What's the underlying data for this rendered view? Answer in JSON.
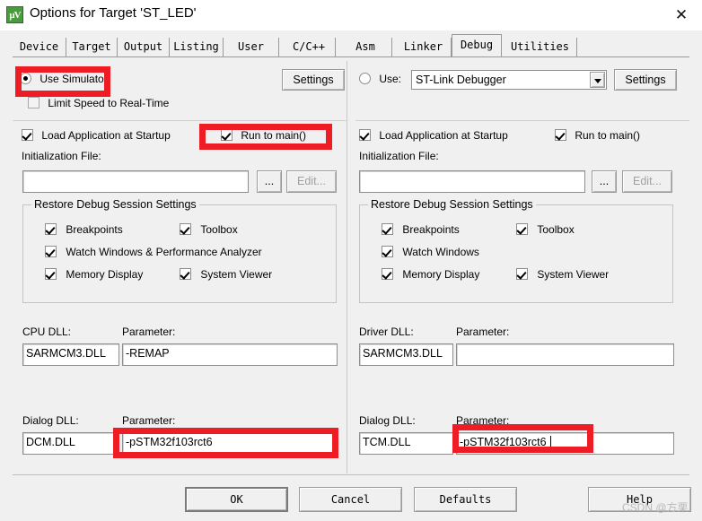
{
  "window": {
    "title": "Options for Target 'ST_LED'",
    "icon": "keil-uvision-icon",
    "close_label": "✕"
  },
  "tabs": [
    {
      "label": "Device",
      "active": false
    },
    {
      "label": "Target",
      "active": false
    },
    {
      "label": "Output",
      "active": false
    },
    {
      "label": "Listing",
      "active": false
    },
    {
      "label": "User",
      "active": false
    },
    {
      "label": "C/C++",
      "active": false
    },
    {
      "label": "Asm",
      "active": false
    },
    {
      "label": "Linker",
      "active": false
    },
    {
      "label": "Debug",
      "active": true
    },
    {
      "label": "Utilities",
      "active": false
    }
  ],
  "left_panel": {
    "use_simulator_label": "Use Simulator",
    "use_simulator_checked": true,
    "settings_label": "Settings",
    "limit_speed_label": "Limit Speed to Real-Time",
    "limit_speed_checked": false,
    "load_app_label": "Load Application at Startup",
    "load_app_checked": true,
    "run_to_main_label": "Run to main()",
    "run_to_main_checked": true,
    "init_file_label": "Initialization File:",
    "init_file_value": "",
    "browse_label": "...",
    "edit_label": "Edit...",
    "restore_group_label": "Restore Debug Session Settings",
    "restore_items": [
      {
        "label": "Breakpoints",
        "checked": true
      },
      {
        "label": "Toolbox",
        "checked": true
      },
      {
        "label": "Watch Windows & Performance Analyzer",
        "checked": true
      },
      {
        "label": "Memory Display",
        "checked": true
      },
      {
        "label": "System Viewer",
        "checked": true
      }
    ],
    "cpu_dll_label": "CPU DLL:",
    "cpu_dll_value": "SARMCM3.DLL",
    "cpu_param_label": "Parameter:",
    "cpu_param_value": "-REMAP",
    "dialog_dll_label": "Dialog DLL:",
    "dialog_dll_value": "DCM.DLL",
    "dialog_param_label": "Parameter:",
    "dialog_param_value": "-pSTM32f103rct6"
  },
  "right_panel": {
    "use_label": "Use:",
    "use_checked": false,
    "debugger_selected": "ST-Link Debugger",
    "settings_label": "Settings",
    "load_app_label": "Load Application at Startup",
    "load_app_checked": true,
    "run_to_main_label": "Run to main()",
    "run_to_main_checked": true,
    "init_file_label": "Initialization File:",
    "init_file_value": "",
    "browse_label": "...",
    "edit_label": "Edit...",
    "restore_group_label": "Restore Debug Session Settings",
    "restore_items": [
      {
        "label": "Breakpoints",
        "checked": true
      },
      {
        "label": "Toolbox",
        "checked": true
      },
      {
        "label": "Watch Windows",
        "checked": true
      },
      {
        "label": "Memory Display",
        "checked": true
      },
      {
        "label": "System Viewer",
        "checked": true
      }
    ],
    "driver_dll_label": "Driver DLL:",
    "driver_dll_value": "SARMCM3.DLL",
    "driver_param_label": "Parameter:",
    "driver_param_value": "",
    "dialog_dll_label": "Dialog DLL:",
    "dialog_dll_value": "TCM.DLL",
    "dialog_param_label": "Parameter:",
    "dialog_param_value": "-pSTM32f103rct6"
  },
  "footer": {
    "ok_label": "OK",
    "cancel_label": "Cancel",
    "defaults_label": "Defaults",
    "help_label": "Help"
  },
  "annotations": {
    "highlight_color": "#ee1c25",
    "watermark_text": "CSDN @方栗"
  }
}
